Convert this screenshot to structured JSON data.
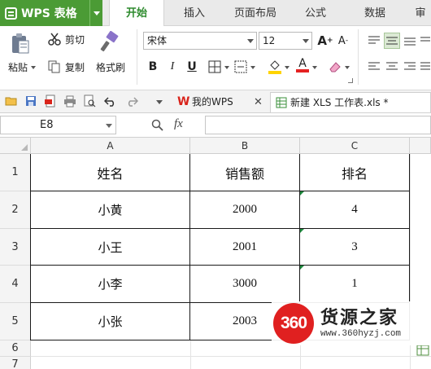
{
  "app": {
    "title": "WPS 表格"
  },
  "tabs": [
    {
      "label": "开始",
      "active": true
    },
    {
      "label": "插入",
      "active": false
    },
    {
      "label": "页面布局",
      "active": false
    },
    {
      "label": "公式",
      "active": false
    },
    {
      "label": "数据",
      "active": false
    },
    {
      "label": "审",
      "active": false
    }
  ],
  "ribbon": {
    "paste_label": "粘贴",
    "cut_label": "剪切",
    "copy_label": "复制",
    "format_painter_label": "格式刷",
    "font_name": "宋体",
    "font_size": "12",
    "bold": "B",
    "italic": "I",
    "underline": "U",
    "grow_font": "A",
    "shrink_font": "A",
    "font_color_glyph": "A"
  },
  "doc_tabs": [
    {
      "label": "我的WPS",
      "active": false
    },
    {
      "label": "新建 XLS 工作表.xls *",
      "active": true
    }
  ],
  "formula_bar": {
    "name_box": "E8",
    "fx_label": "fx",
    "content": ""
  },
  "sheet": {
    "columns": [
      "A",
      "B",
      "C"
    ],
    "rows": [
      "1",
      "2",
      "3",
      "4",
      "5",
      "6",
      "7"
    ],
    "header_row": [
      "姓名",
      "销售额",
      "排名"
    ],
    "data": [
      [
        "小黄",
        "2000",
        "4"
      ],
      [
        "小王",
        "2001",
        "3"
      ],
      [
        "小李",
        "3000",
        "1"
      ],
      [
        "小张",
        "2003",
        ""
      ]
    ],
    "accent_color": "#1e8b3e"
  },
  "watermark": {
    "badge": "360",
    "name": "货源之家",
    "url": "www.360hyzj.com"
  },
  "colors": {
    "app_green": "#4b9b35",
    "active_tab_text": "#2e8b2e",
    "wps_red": "#d9241b",
    "watermark_red": "#e02020"
  }
}
